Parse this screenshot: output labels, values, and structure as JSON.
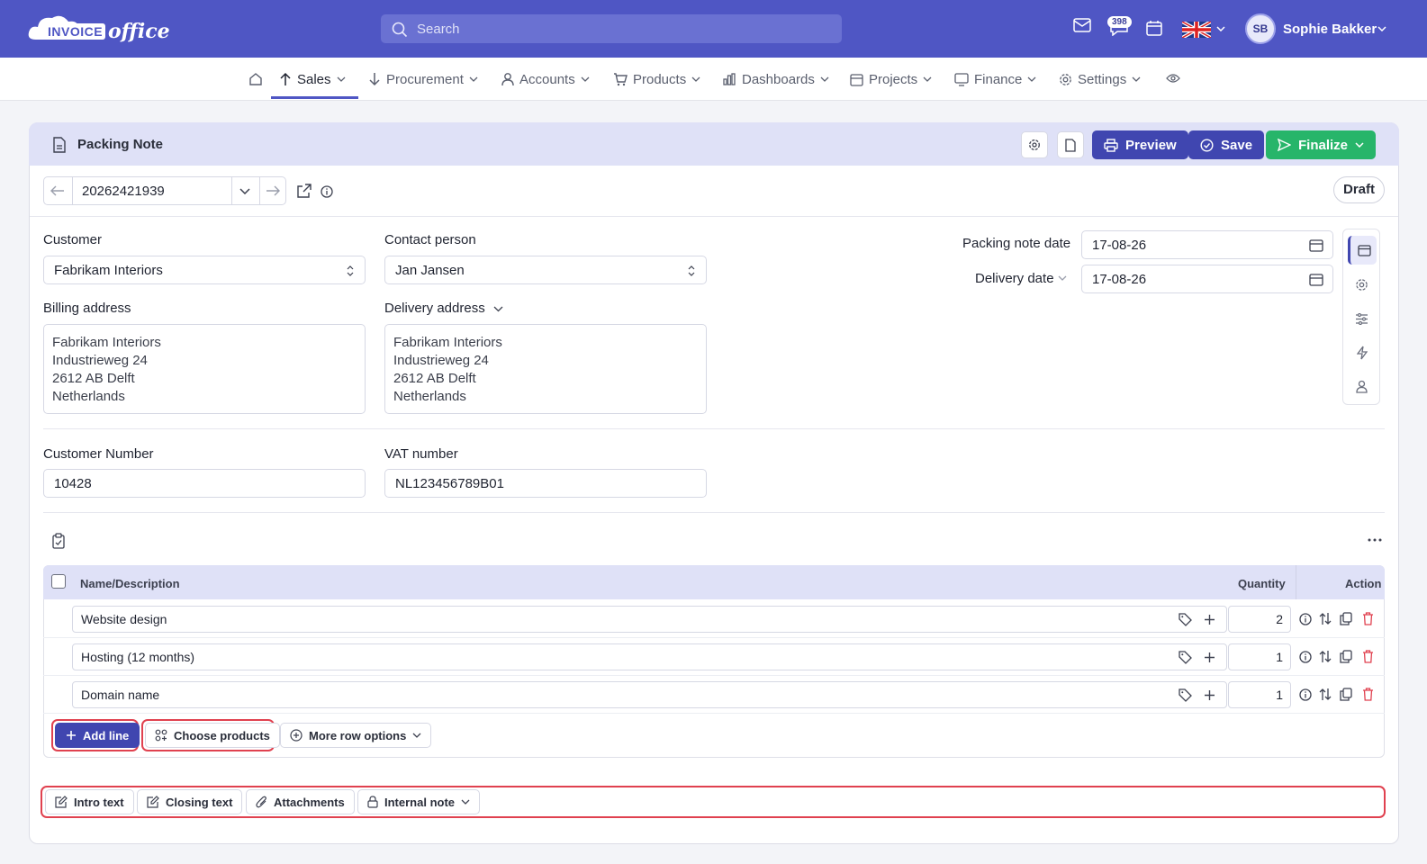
{
  "brand": {
    "logo_text_1": "INVOICE",
    "logo_text_2": "office"
  },
  "search": {
    "placeholder": "Search"
  },
  "topbar": {
    "notification_count": "398",
    "user_initials": "SB",
    "user_name": "Sophie Bakker"
  },
  "nav": {
    "items": [
      {
        "label": "Sales"
      },
      {
        "label": "Procurement"
      },
      {
        "label": "Accounts"
      },
      {
        "label": "Products"
      },
      {
        "label": "Dashboards"
      },
      {
        "label": "Projects"
      },
      {
        "label": "Finance"
      },
      {
        "label": "Settings"
      }
    ]
  },
  "document": {
    "title": "Packing Note",
    "number": "20262421939",
    "status": "Draft",
    "actions": {
      "preview": "Preview",
      "save": "Save",
      "finalize": "Finalize"
    }
  },
  "form": {
    "customer_label": "Customer",
    "customer_value": "Fabrikam Interiors",
    "contact_label": "Contact person",
    "contact_value": "Jan Jansen",
    "billing_label": "Billing address",
    "billing_lines": [
      "Fabrikam Interiors",
      "Industrieweg 24",
      "2612 AB Delft",
      "Netherlands"
    ],
    "delivery_label": "Delivery address",
    "delivery_lines": [
      "Fabrikam Interiors",
      "Industrieweg 24",
      "2612 AB Delft",
      "Netherlands"
    ],
    "packing_date_label": "Packing note date",
    "packing_date_value": "17-08-26",
    "delivery_date_label": "Delivery date",
    "delivery_date_value": "17-08-26",
    "customer_number_label": "Customer Number",
    "customer_number_value": "10428",
    "vat_label": "VAT number",
    "vat_value": "NL123456789B01"
  },
  "table": {
    "headers": {
      "name": "Name/Description",
      "quantity": "Quantity",
      "action": "Action"
    },
    "rows": [
      {
        "name": "Website design",
        "quantity": "2"
      },
      {
        "name": "Hosting (12 months)",
        "quantity": "1"
      },
      {
        "name": "Domain name",
        "quantity": "1"
      }
    ],
    "buttons": {
      "add_line": "Add line",
      "choose_products": "Choose products",
      "more_row_options": "More row options"
    }
  },
  "footer_buttons": {
    "intro_text": "Intro text",
    "closing_text": "Closing text",
    "attachments": "Attachments",
    "internal_note": "Internal note"
  },
  "colors": {
    "brand": "#4f56c4",
    "primary": "#4046b0",
    "success": "#27b56a",
    "danger": "#e0414f",
    "header_tint": "#dfe1f7"
  }
}
